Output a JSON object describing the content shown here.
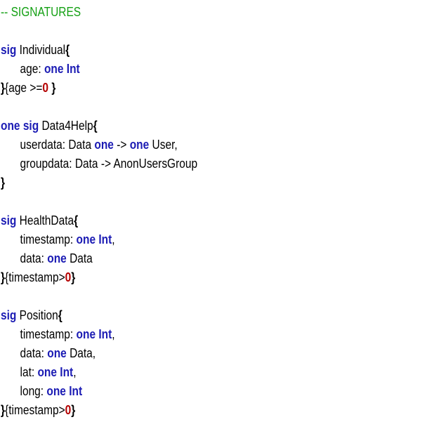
{
  "lines": [
    {
      "indent": false,
      "tokens": [
        {
          "t": "comment",
          "v": "-- SIGNATURES"
        }
      ]
    },
    {
      "indent": false,
      "tokens": []
    },
    {
      "indent": false,
      "tokens": [
        {
          "t": "keyword",
          "v": "sig"
        },
        {
          "t": "plain",
          "v": " Individual"
        },
        {
          "t": "brace",
          "v": "{"
        }
      ]
    },
    {
      "indent": true,
      "tokens": [
        {
          "t": "plain",
          "v": "age: "
        },
        {
          "t": "keyword",
          "v": "one Int"
        }
      ]
    },
    {
      "indent": false,
      "tokens": [
        {
          "t": "brace",
          "v": "}"
        },
        {
          "t": "plain",
          "v": "{age >="
        },
        {
          "t": "number",
          "v": "0"
        },
        {
          "t": "plain",
          "v": " "
        },
        {
          "t": "brace",
          "v": "}"
        }
      ]
    },
    {
      "indent": false,
      "tokens": []
    },
    {
      "indent": false,
      "tokens": [
        {
          "t": "keyword",
          "v": "one sig"
        },
        {
          "t": "plain",
          "v": " Data4Help"
        },
        {
          "t": "brace",
          "v": "{"
        }
      ]
    },
    {
      "indent": true,
      "tokens": [
        {
          "t": "plain",
          "v": "userdata: Data "
        },
        {
          "t": "keyword",
          "v": "one"
        },
        {
          "t": "plain",
          "v": " -> "
        },
        {
          "t": "keyword",
          "v": "one"
        },
        {
          "t": "plain",
          "v": " User,"
        }
      ]
    },
    {
      "indent": true,
      "tokens": [
        {
          "t": "plain",
          "v": "groupdata: Data -> AnonUsersGroup"
        }
      ]
    },
    {
      "indent": false,
      "tokens": [
        {
          "t": "brace",
          "v": "}"
        }
      ]
    },
    {
      "indent": false,
      "tokens": []
    },
    {
      "indent": false,
      "tokens": [
        {
          "t": "keyword",
          "v": "sig"
        },
        {
          "t": "plain",
          "v": " HealthData"
        },
        {
          "t": "brace",
          "v": "{"
        }
      ]
    },
    {
      "indent": true,
      "tokens": [
        {
          "t": "plain",
          "v": "timestamp: "
        },
        {
          "t": "keyword",
          "v": "one Int"
        },
        {
          "t": "plain",
          "v": ","
        }
      ]
    },
    {
      "indent": true,
      "tokens": [
        {
          "t": "plain",
          "v": "data: "
        },
        {
          "t": "keyword",
          "v": "one"
        },
        {
          "t": "plain",
          "v": " Data"
        }
      ]
    },
    {
      "indent": false,
      "tokens": [
        {
          "t": "brace",
          "v": "}"
        },
        {
          "t": "plain",
          "v": "{timestamp>"
        },
        {
          "t": "number",
          "v": "0"
        },
        {
          "t": "brace",
          "v": "}"
        }
      ]
    },
    {
      "indent": false,
      "tokens": []
    },
    {
      "indent": false,
      "tokens": [
        {
          "t": "keyword",
          "v": "sig"
        },
        {
          "t": "plain",
          "v": " Position"
        },
        {
          "t": "brace",
          "v": "{"
        }
      ]
    },
    {
      "indent": true,
      "tokens": [
        {
          "t": "plain",
          "v": "timestamp: "
        },
        {
          "t": "keyword",
          "v": "one Int"
        },
        {
          "t": "plain",
          "v": ","
        }
      ]
    },
    {
      "indent": true,
      "tokens": [
        {
          "t": "plain",
          "v": "data: "
        },
        {
          "t": "keyword",
          "v": "one"
        },
        {
          "t": "plain",
          "v": " Data,"
        }
      ]
    },
    {
      "indent": true,
      "tokens": [
        {
          "t": "plain",
          "v": "lat: "
        },
        {
          "t": "keyword",
          "v": "one Int"
        },
        {
          "t": "plain",
          "v": ","
        }
      ]
    },
    {
      "indent": true,
      "tokens": [
        {
          "t": "plain",
          "v": "long: "
        },
        {
          "t": "keyword",
          "v": "one Int"
        }
      ]
    },
    {
      "indent": false,
      "tokens": [
        {
          "t": "brace",
          "v": "}"
        },
        {
          "t": "plain",
          "v": "{timestamp>"
        },
        {
          "t": "number",
          "v": "0"
        },
        {
          "t": "brace",
          "v": "}"
        }
      ]
    }
  ]
}
